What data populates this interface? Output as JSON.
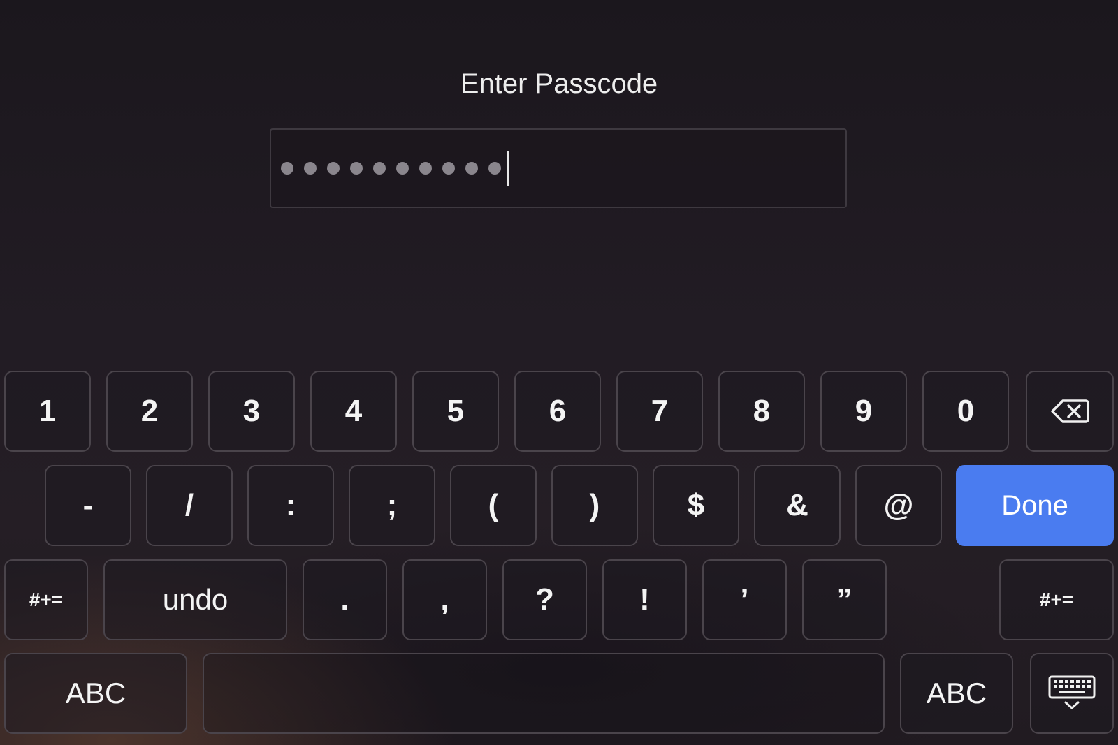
{
  "header": {
    "title": "Enter Passcode"
  },
  "passcode": {
    "masked_count": 10
  },
  "keyboard": {
    "row1": [
      "1",
      "2",
      "3",
      "4",
      "5",
      "6",
      "7",
      "8",
      "9",
      "0"
    ],
    "row2": [
      "-",
      "/",
      ":",
      ";",
      "(",
      ")",
      "$",
      "&",
      "@"
    ],
    "done_label": "Done",
    "row3_left_toggle": "#+=",
    "undo_label": "undo",
    "row3": [
      ".",
      ",",
      "?",
      "!",
      "’",
      "”"
    ],
    "row3_right_toggle": "#+=",
    "abc_left": "ABC",
    "abc_right": "ABC",
    "icons": [
      "delete-icon",
      "hide-keyboard-icon"
    ],
    "accent_color": "#4a7cf0"
  }
}
